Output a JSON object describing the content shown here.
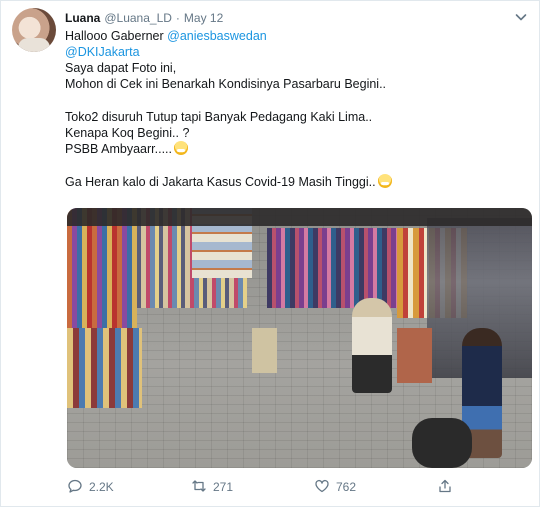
{
  "tweet": {
    "author": {
      "name": "Luana",
      "handle": "@Luana_LD",
      "separator": "·",
      "date": "May 12"
    },
    "lines": [
      {
        "parts": [
          {
            "text": "Hallooo Gaberner "
          },
          {
            "text": "@aniesbaswedan",
            "mention": true
          }
        ]
      },
      {
        "parts": [
          {
            "text": "@DKIJakarta",
            "mention": true
          }
        ]
      },
      {
        "parts": [
          {
            "text": "Saya dapat Foto ini,"
          }
        ]
      },
      {
        "parts": [
          {
            "text": "Mohon di Cek ini Benarkah Kondisinya Pasarbaru Begini.."
          }
        ]
      },
      {
        "gap": true
      },
      {
        "parts": [
          {
            "text": "Toko2 disuruh Tutup tapi Banyak Pedagang Kaki Lima.."
          }
        ]
      },
      {
        "parts": [
          {
            "text": "Kenapa Koq Begini.. ?"
          }
        ]
      },
      {
        "parts": [
          {
            "text": "PSBB Ambyaarr....."
          }
        ],
        "emoji": "face-with-medical-mask"
      },
      {
        "gap": true
      },
      {
        "parts": [
          {
            "text": "Ga Heran kalo di Jakarta Kasus Covid-19 Masih Tinggi.."
          }
        ],
        "emoji": "face-with-medical-mask"
      }
    ],
    "photo": {
      "subject": "market"
    },
    "actions": {
      "reply_count": "2.2K",
      "retweet_count": "271",
      "like_count": "762"
    }
  },
  "colors": {
    "mention": "#1b95e0",
    "muted": "#657786",
    "text": "#14171a"
  },
  "icons": {
    "menu": "chevron-down-icon",
    "reply": "reply-icon",
    "retweet": "retweet-icon",
    "like": "heart-icon",
    "share": "share-icon"
  }
}
